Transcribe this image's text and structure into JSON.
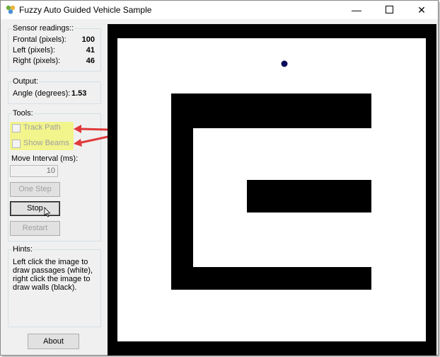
{
  "window": {
    "title": "Fuzzy Auto Guided Vehicle Sample",
    "min_glyph": "—",
    "close_glyph": "✕"
  },
  "sensors": {
    "title": "Sensor readings::",
    "rows": [
      {
        "label": "Frontal (pixels):",
        "value": "100"
      },
      {
        "label": "Left (pixels):",
        "value": "41"
      },
      {
        "label": "Right (pixels):",
        "value": "46"
      }
    ]
  },
  "output": {
    "title": "Output:",
    "label": "Angle (degrees):",
    "value": "1.53"
  },
  "tools": {
    "title": "Tools:",
    "track_path": {
      "label": "Track Path",
      "checked": false
    },
    "show_beams": {
      "label": "Show Beams",
      "checked": false
    },
    "interval_label": "Move Interval (ms):",
    "interval_value": "10",
    "one_step_label": "One Step",
    "stop_label": "Stop",
    "restart_label": "Restart"
  },
  "hints": {
    "title": "Hints:",
    "text": "Left click the image to draw passages (white), right click the image to draw walls (black)."
  },
  "about_label": "About",
  "colors": {
    "annotation_arrow": "#e0393b",
    "highlight": "#f2f47a",
    "vehicle": "#0b0b5c"
  },
  "icons": {
    "app_icon": "fuzzy-app-icon",
    "cursor": "mouse-cursor-icon"
  }
}
